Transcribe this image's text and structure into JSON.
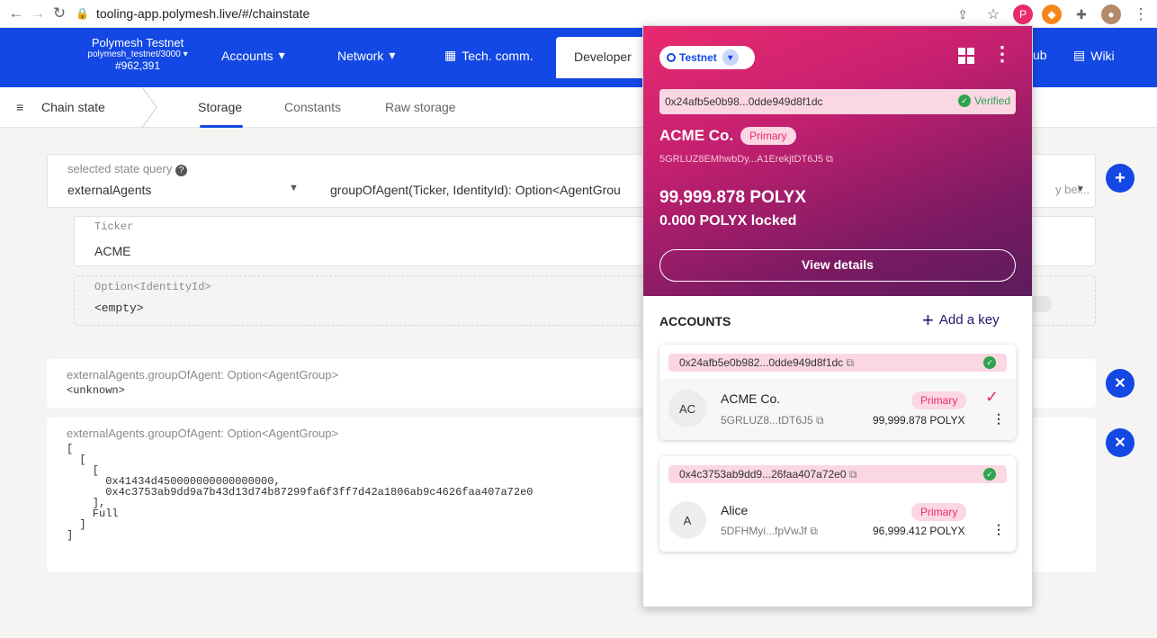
{
  "browser": {
    "url": "tooling-app.polymesh.live/#/chainstate"
  },
  "topbar": {
    "network_name": "Polymesh Testnet",
    "network_endpoint": "polymesh_testnet/3000",
    "block": "#962,391",
    "menu": [
      "Accounts",
      "Network",
      "Tech. comm.",
      "Developer"
    ],
    "right_items": [
      "ub",
      "Wiki"
    ]
  },
  "subnav": {
    "section": "Chain state",
    "tabs": [
      "Storage",
      "Constants",
      "Raw storage"
    ]
  },
  "query": {
    "label": "selected state query",
    "module": "externalAgents",
    "method": "groupOfAgent(Ticker, IdentityId): Option<AgentGrou",
    "right_hint": "y bel...",
    "ticker_label": "Ticker",
    "ticker_value": "ACME",
    "option_label": "Option<IdentityId>",
    "option_value": "<empty>"
  },
  "results": [
    {
      "title": "externalAgents.groupOfAgent: Option<AgentGroup>",
      "value": "<unknown>"
    },
    {
      "title": "externalAgents.groupOfAgent: Option<AgentGroup>",
      "value": "[\n  [\n    [\n      0x41434d450000000000000000,\n      0x4c3753ab9dd9a7b43d13d74b87299fa6f3ff7d42a1806ab9c4626faa407a72e0\n    ],\n    Full\n  ]\n]"
    }
  ],
  "wallet": {
    "network": "Testnet",
    "address": "0x24afb5e0b98...0dde949d8f1dc",
    "verified": "Verified",
    "identity_name": "ACME Co.",
    "identity_badge": "Primary",
    "identity_key": "5GRLUZ8EMhwbDy...A1ErekjtDT6J5",
    "balance": "99,999.878  POLYX",
    "locked": "0.000 POLYX  locked",
    "view_details": "View details",
    "accounts_title": "ACCOUNTS",
    "add_key": "Add a key",
    "accounts": [
      {
        "did": "0x24afb5e0b982...0dde949d8f1dc",
        "initials": "AC",
        "name": "ACME Co.",
        "badge": "Primary",
        "key": "5GRLUZ8...tDT6J5",
        "balance": "99,999.878 POLYX"
      },
      {
        "did": "0x4c3753ab9dd9...26faa407a72e0",
        "initials": "A",
        "name": "Alice",
        "badge": "Primary",
        "key": "5DFHMyi...fpVwJf",
        "balance": "96,999.412 POLYX"
      }
    ]
  }
}
